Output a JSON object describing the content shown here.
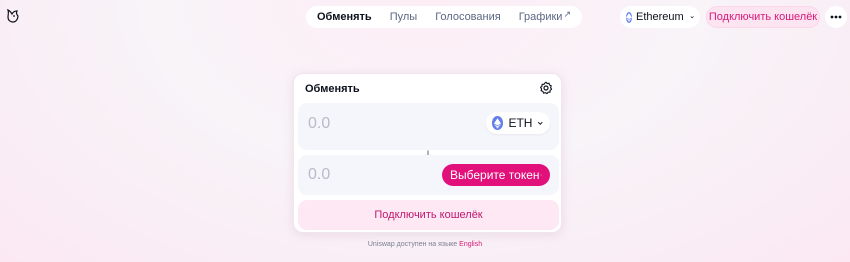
{
  "header": {
    "logo_icon": "unicorn-icon",
    "nav": [
      {
        "label": "Обменять",
        "active": true
      },
      {
        "label": "Пулы",
        "active": false
      },
      {
        "label": "Голосования",
        "active": false
      },
      {
        "label": "Графики",
        "active": false,
        "external_icon": "↗"
      }
    ],
    "network": {
      "label": "Ethereum",
      "icon": "ethereum-icon"
    },
    "connect_label": "Подключить кошелёк",
    "more_icon": "more-icon"
  },
  "swap": {
    "title": "Обменять",
    "settings_icon": "gear-icon",
    "input": {
      "placeholder": "0.0",
      "token": "ETH"
    },
    "output": {
      "placeholder": "0.0",
      "select_label": "Выберите токен"
    },
    "swap_icon": "arrow-down-icon",
    "connect_label": "Подключить кошелёк"
  },
  "footer": {
    "text": "Uniswap доступен на языке",
    "lang": "English"
  },
  "colors": {
    "accent": "#e1107a",
    "accent_soft": "#fde8f3",
    "eth": "#627eea"
  }
}
